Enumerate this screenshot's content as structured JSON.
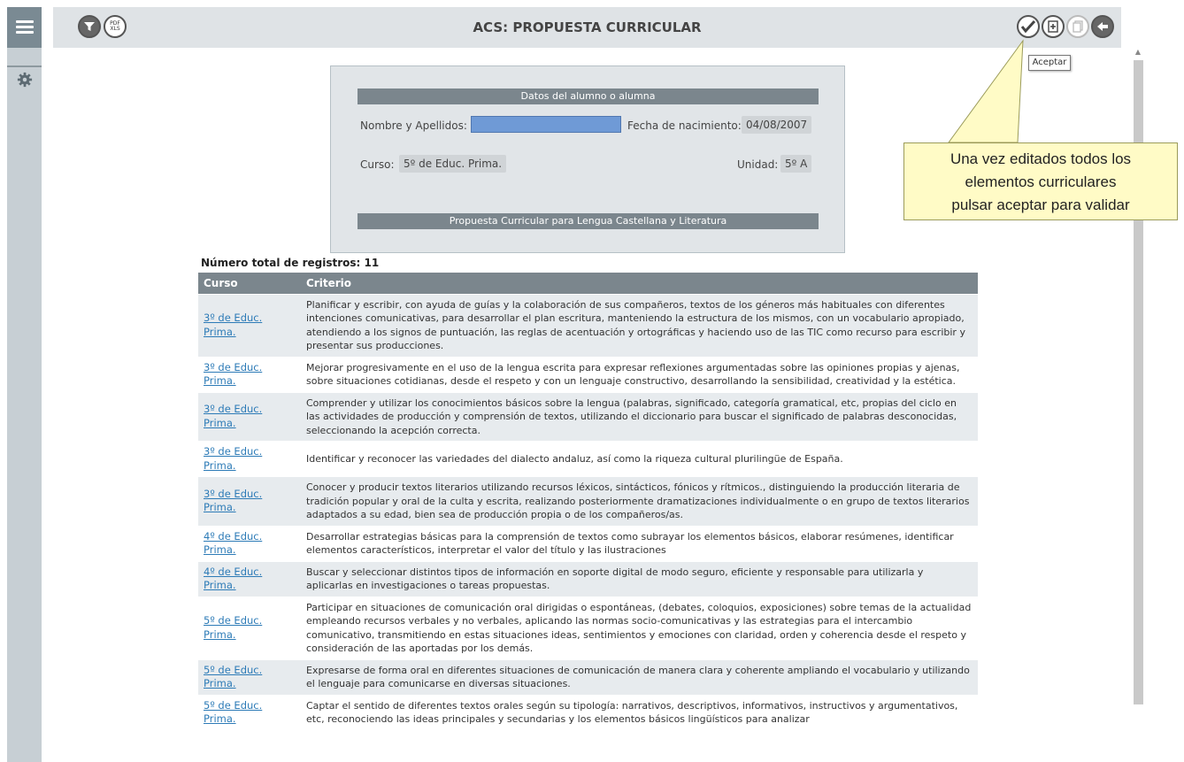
{
  "header": {
    "title": "ACS: PROPUESTA CURRICULAR",
    "filter_icon": "filter-icon",
    "export_icon": "pdf-xls-export-icon",
    "export_label": "PDF XLS",
    "accept_icon": "checkmark-icon",
    "add_doc_icon": "add-document-icon",
    "copy_doc_icon": "copy-document-icon",
    "back_icon": "back-arrow-icon"
  },
  "tooltip": "Aceptar",
  "callout": {
    "line1": "Una vez editados todos los",
    "line2": "elementos curriculares",
    "line3": "pulsar aceptar para validar"
  },
  "student_panel": {
    "section_title": "Datos del alumno o alumna",
    "name_label": "Nombre y Apellidos:",
    "name_value": "",
    "birthdate_label": "Fecha de nacimiento:",
    "birthdate_value": "04/08/2007",
    "course_label": "Curso:",
    "course_value": "5º de Educ. Prima.",
    "unit_label": "Unidad:",
    "unit_value": "5º A",
    "proposal_title": "Propuesta Curricular para Lengua Castellana y Literatura"
  },
  "records": {
    "total_label": "Número total de registros: 11",
    "columns": [
      "Curso",
      "Criterio"
    ],
    "rows": [
      {
        "course": "3º de Educ. Prima.",
        "criterion": "Planificar y escribir, con ayuda de guías y la colaboración de sus compañeros, textos de los géneros más habituales con diferentes intenciones comunicativas, para desarrollar el plan escritura, manteniendo la estructura de los mismos, con un vocabulario apropiado, atendiendo a los signos de puntuación, las reglas de acentuación y ortográficas y haciendo uso de las TIC como recurso para escribir y presentar sus producciones."
      },
      {
        "course": "3º de Educ. Prima.",
        "criterion": "Mejorar progresivamente en el uso de la lengua escrita para expresar reflexiones argumentadas sobre las opiniones propias y ajenas, sobre situaciones cotidianas, desde el respeto y con un lenguaje constructivo, desarrollando la sensibilidad, creatividad y la estética."
      },
      {
        "course": "3º de Educ. Prima.",
        "criterion": "Comprender y utilizar los conocimientos básicos sobre la lengua (palabras, significado, categoría gramatical, etc, propias del ciclo en las actividades de producción y comprensión de textos, utilizando el diccionario para buscar el significado de palabras desconocidas, seleccionando la acepción correcta."
      },
      {
        "course": "3º de Educ. Prima.",
        "criterion": "Identificar y reconocer las variedades del dialecto andaluz, así como la riqueza cultural plurilingüe de España."
      },
      {
        "course": "3º de Educ. Prima.",
        "criterion": "Conocer y producir textos literarios utilizando recursos léxicos, sintácticos, fónicos y rítmicos., distinguiendo la producción literaria de tradición popular y oral de la culta y escrita, realizando posteriormente dramatizaciones individualmente o en grupo de textos literarios adaptados a su edad, bien sea de producción propia o de los compañeros/as."
      },
      {
        "course": "4º de Educ. Prima.",
        "criterion": "Desarrollar estrategias básicas para la comprensión de textos como subrayar los elementos básicos, elaborar resúmenes, identificar elementos característicos, interpretar el valor del título y las ilustraciones"
      },
      {
        "course": "4º de Educ. Prima.",
        "criterion": "Buscar y seleccionar distintos tipos de información en soporte digital de modo seguro, eficiente y responsable para utilizarla y aplicarlas en investigaciones o tareas propuestas."
      },
      {
        "course": "5º de Educ. Prima.",
        "criterion": "Participar en situaciones de comunicación oral dirigidas o espontáneas, (debates, coloquios, exposiciones) sobre temas de la actualidad empleando recursos verbales y no verbales, aplicando las normas socio-comunicativas y las estrategias para el intercambio comunicativo, transmitiendo en estas situaciones ideas, sentimientos y emociones con claridad, orden y coherencia desde el respeto y consideración de las aportadas por los demás."
      },
      {
        "course": "5º de Educ. Prima.",
        "criterion": "Expresarse de forma oral en diferentes situaciones de comunicación de manera clara y coherente ampliando el vocabulario y utilizando el lenguaje para comunicarse en diversas situaciones."
      },
      {
        "course": "5º de Educ. Prima.",
        "criterion": "Captar el sentido de diferentes textos orales según su tipología: narrativos, descriptivos, informativos, instructivos y argumentativos, etc, reconociendo las ideas principales y secundarias y los elementos básicos lingüísticos para analizar"
      }
    ]
  }
}
